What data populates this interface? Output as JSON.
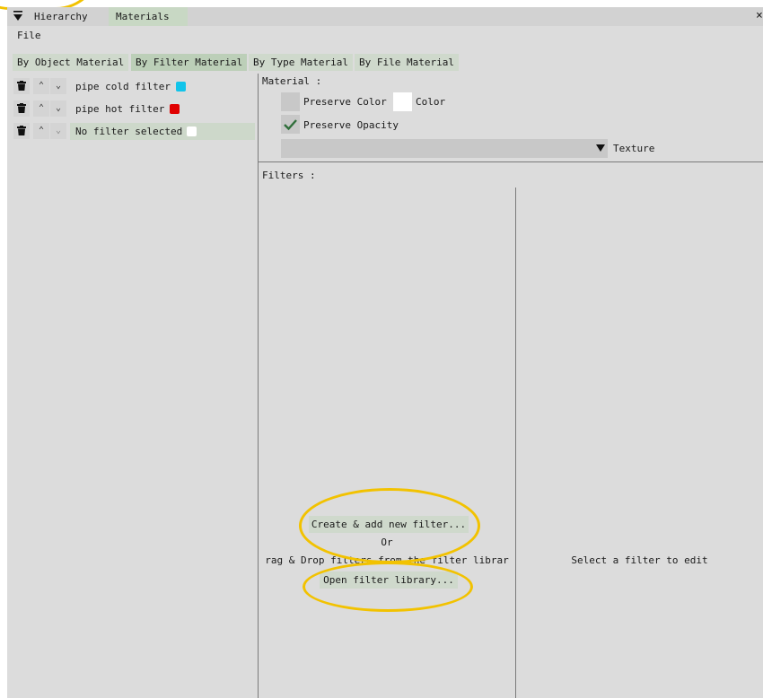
{
  "window": {
    "tabs": [
      {
        "label": "Hierarchy"
      },
      {
        "label": "Materials"
      }
    ],
    "close_glyph": "×",
    "menu_file": "File"
  },
  "subtabs": [
    {
      "label": "By Object Material"
    },
    {
      "label": "By Filter Material"
    },
    {
      "label": "By Type Material"
    },
    {
      "label": "By File Material"
    }
  ],
  "filters_list": [
    {
      "label": "pipe cold filter",
      "color": "#12c4ea"
    },
    {
      "label": "pipe hot filter",
      "color": "#e00000"
    },
    {
      "label": "No filter selected",
      "color": "#ffffff"
    }
  ],
  "material": {
    "heading": "Material :",
    "preserve_color": "Preserve Color",
    "color_label": "Color",
    "color_value": "#ffffff",
    "preserve_opacity": "Preserve Opacity",
    "preserve_opacity_checked": true,
    "texture_label": "Texture"
  },
  "filters": {
    "heading": "Filters :",
    "create_button": "Create & add new filter...",
    "or_text": "Or",
    "drag_text": "rag & Drop filters from the filter librar",
    "open_library_button": "Open filter library...",
    "select_hint": "Select a filter to edit"
  },
  "icons": {
    "collapse": "collapse-triangle-icon",
    "trash": "trash-icon",
    "up": "chevron-up-icon",
    "down": "chevron-down-icon",
    "check": "checkmark-icon",
    "dropdown": "dropdown-triangle-icon"
  },
  "colors": {
    "panel_bg": "#dcdcdc",
    "tab_active": "#c8d8c4",
    "annotation": "#f2c200"
  }
}
